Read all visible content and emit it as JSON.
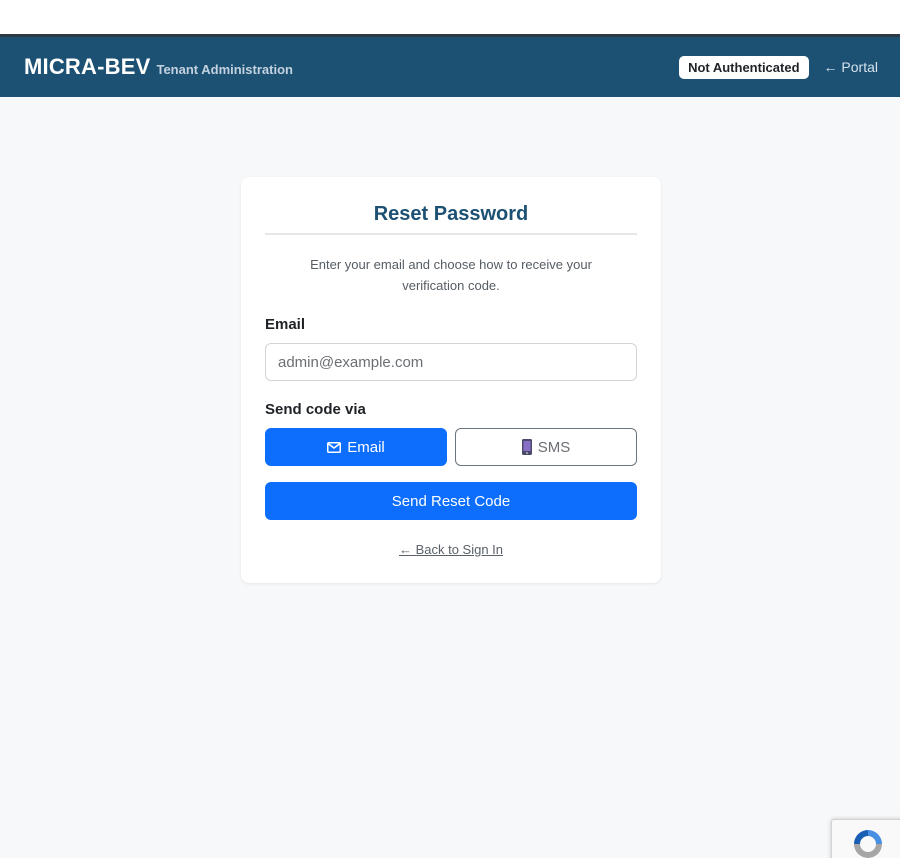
{
  "navbar": {
    "brand_name": "MICRA-BEV",
    "brand_subtitle": "Tenant Administration",
    "auth_status": "Not Authenticated",
    "portal_link": "← Portal",
    "background_color": "#1c5174"
  },
  "card": {
    "title": "Reset Password",
    "intro": "Enter your email and choose how to receive your verification code.",
    "email_label": "Email",
    "email_placeholder": "admin@example.com",
    "email_value": "",
    "send_via_label": "Send code via",
    "methods": [
      {
        "label": "Email",
        "icon": "envelope-icon",
        "selected": true
      },
      {
        "label": "SMS",
        "icon": "mobile-phone-icon",
        "selected": false
      }
    ],
    "submit_label": "Send Reset Code",
    "back_link": "← Back to Sign In"
  },
  "colors": {
    "primary": "#0d6efd",
    "title": "#1c5174"
  },
  "recaptcha": {
    "icon": "recaptcha-icon"
  }
}
